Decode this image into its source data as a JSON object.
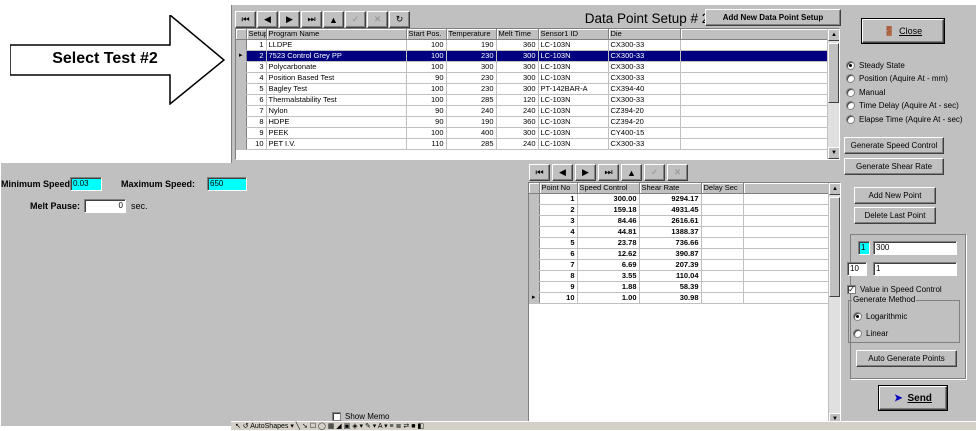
{
  "callout": {
    "text": "Select Test #2"
  },
  "window": {
    "title": "Data Point Setup # 2",
    "add_button": "Add New Data Point Setup",
    "close_button": "Close",
    "nav": {
      "first": "⏮",
      "prev": "◀",
      "next": "▶",
      "last": "⏭",
      "up": "▲",
      "check": "✓",
      "cancel": "✕",
      "refresh": "↻"
    }
  },
  "setups": {
    "columns": [
      "Setup #",
      "Program Name",
      "Start Pos.",
      "Temperature",
      "Melt Time",
      "Sensor1 ID",
      "Die"
    ],
    "rows": [
      [
        "1",
        "LLDPE",
        "100",
        "190",
        "360",
        "LC-103N",
        "CX300-33"
      ],
      [
        "2",
        "7523 Control Grey PP",
        "100",
        "230",
        "300",
        "LC-103N",
        "CX300-33"
      ],
      [
        "3",
        "Polycarbonate",
        "100",
        "300",
        "300",
        "LC-103N",
        "CX300-33"
      ],
      [
        "4",
        "Position Based Test",
        "90",
        "230",
        "300",
        "LC-103N",
        "CX300-33"
      ],
      [
        "5",
        "Bagley Test",
        "100",
        "230",
        "300",
        "PT-142BAR-A",
        "CX394-40"
      ],
      [
        "6",
        "Thermalstability Test",
        "100",
        "285",
        "120",
        "LC-103N",
        "CX300-33"
      ],
      [
        "7",
        "Nylon",
        "90",
        "240",
        "240",
        "LC-103N",
        "CZ394-20"
      ],
      [
        "8",
        "HDPE",
        "90",
        "190",
        "360",
        "LC-103N",
        "CZ394-20"
      ],
      [
        "9",
        "PEEK",
        "100",
        "400",
        "300",
        "LC-103N",
        "CY400-15"
      ],
      [
        "10",
        "PET I.V.",
        "110",
        "285",
        "240",
        "LC-103N",
        "CX300-33"
      ]
    ],
    "selected_index": 1
  },
  "speed": {
    "min_label": "Minimum Speed:",
    "min_value": "0.03",
    "max_label": "Maximum Speed:",
    "max_value": "650",
    "pause_label": "Melt Pause:",
    "pause_value": "0",
    "pause_unit": "sec."
  },
  "memo": {
    "label": "Show Memo"
  },
  "points": {
    "columns": [
      "Point No",
      "Speed Control",
      "Shear Rate",
      "Delay Sec"
    ],
    "rows": [
      [
        "1",
        "300.00",
        "9294.17",
        ""
      ],
      [
        "2",
        "159.18",
        "4931.45",
        ""
      ],
      [
        "3",
        "84.46",
        "2616.61",
        ""
      ],
      [
        "4",
        "44.81",
        "1388.37",
        ""
      ],
      [
        "5",
        "23.78",
        "736.66",
        ""
      ],
      [
        "6",
        "12.62",
        "390.87",
        ""
      ],
      [
        "7",
        "6.69",
        "207.39",
        ""
      ],
      [
        "8",
        "3.55",
        "110.04",
        ""
      ],
      [
        "9",
        "1.88",
        "58.39",
        ""
      ],
      [
        "10",
        "1.00",
        "30.98",
        ""
      ]
    ]
  },
  "modes": [
    {
      "label": "Steady State",
      "checked": true
    },
    {
      "label": "Position (Aquire At - mm)",
      "checked": false
    },
    {
      "label": "Manual",
      "checked": false
    },
    {
      "label": "Time Delay (Aquire At - sec)",
      "checked": false
    },
    {
      "label": "Elapse Time (Aquire At - sec)",
      "checked": false
    }
  ],
  "buttons": {
    "gen_speed": "Generate Speed Control",
    "gen_shear": "Generate Shear Rate",
    "add_point": "Add New Point",
    "delete_point": "Delete Last Point",
    "auto_gen": "Auto Generate Points",
    "send": "Send"
  },
  "gen_fields": {
    "a": "1",
    "b": "300",
    "c": "10",
    "d": "1"
  },
  "value_in_speed": {
    "label": "Value in Speed Control",
    "checked": true
  },
  "gen_method": {
    "title": "Generate Method",
    "options": [
      {
        "label": "Logarithmic",
        "checked": true
      },
      {
        "label": "Linear",
        "checked": false
      }
    ]
  },
  "taskbar": {
    "text": "↖ ↺  AutoShapes ▾  ╲  ➘  ☐  ◯  ▦  ◢  ▣  ◈ ▾  ✎ ▾  A ▾  ≡  ≣  ⇄  ■  ◧"
  }
}
